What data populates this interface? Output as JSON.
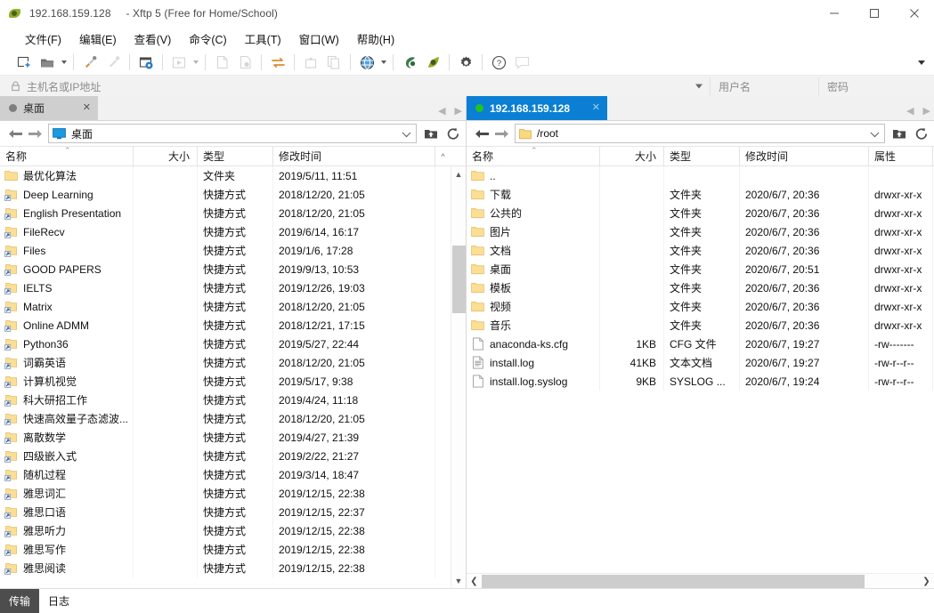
{
  "window": {
    "title_host": "192.168.159.128",
    "title_app": "- Xftp 5 (Free for Home/School)",
    "minimize_label": "—",
    "maximize_label": "□",
    "close_label": "✕"
  },
  "menubar": {
    "items": [
      {
        "label": "文件(F)"
      },
      {
        "label": "编辑(E)"
      },
      {
        "label": "查看(V)"
      },
      {
        "label": "命令(C)"
      },
      {
        "label": "工具(T)"
      },
      {
        "label": "窗口(W)"
      },
      {
        "label": "帮助(H)"
      }
    ]
  },
  "toolbar": {
    "buttons": [
      {
        "name": "new-session-icon"
      },
      {
        "name": "open-folder-icon"
      },
      {
        "name": "connect-icon"
      },
      {
        "name": "disconnect-icon"
      },
      {
        "name": "session-properties-icon"
      },
      {
        "name": "transfer-start-icon"
      },
      {
        "name": "new-file-icon"
      },
      {
        "name": "edit-file-icon"
      },
      {
        "name": "sync-browse-icon"
      },
      {
        "name": "upload-icon"
      },
      {
        "name": "copy-icon"
      },
      {
        "name": "browser-icon"
      },
      {
        "name": "xshell-icon"
      },
      {
        "name": "xftp-icon"
      },
      {
        "name": "options-icon"
      },
      {
        "name": "help-icon"
      },
      {
        "name": "feedback-icon"
      }
    ],
    "overflow_label": "▾"
  },
  "loginbar": {
    "host_placeholder": "主机名或IP地址",
    "host_value": "",
    "username_placeholder": "用户名",
    "username_value": "",
    "password_placeholder": "密码",
    "password_value": ""
  },
  "columns": {
    "name": "名称",
    "size": "大小",
    "type": "类型",
    "modified": "修改时间",
    "attr": "属性",
    "sort_mark": "⌃"
  },
  "left_pane": {
    "tab": {
      "label": "桌面",
      "close": "✕",
      "active": false
    },
    "path": "桌面",
    "nav_back": "←",
    "nav_forward": "→",
    "up_button": "up-folder-icon",
    "refresh_button": "refresh-icon",
    "rows": [
      {
        "name": "最优化算法",
        "size": "",
        "type": "文件夹",
        "modified": "2019/5/11, 11:51",
        "icon": "folder"
      },
      {
        "name": "Deep Learning",
        "size": "",
        "type": "快捷方式",
        "modified": "2018/12/20, 21:05",
        "icon": "shortcut"
      },
      {
        "name": "English Presentation",
        "size": "",
        "type": "快捷方式",
        "modified": "2018/12/20, 21:05",
        "icon": "shortcut"
      },
      {
        "name": "FileRecv",
        "size": "",
        "type": "快捷方式",
        "modified": "2019/6/14, 16:17",
        "icon": "shortcut"
      },
      {
        "name": "Files",
        "size": "",
        "type": "快捷方式",
        "modified": "2019/1/6, 17:28",
        "icon": "shortcut"
      },
      {
        "name": "GOOD PAPERS",
        "size": "",
        "type": "快捷方式",
        "modified": "2019/9/13, 10:53",
        "icon": "shortcut"
      },
      {
        "name": "IELTS",
        "size": "",
        "type": "快捷方式",
        "modified": "2019/12/26, 19:03",
        "icon": "shortcut"
      },
      {
        "name": "Matrix",
        "size": "",
        "type": "快捷方式",
        "modified": "2018/12/20, 21:05",
        "icon": "shortcut"
      },
      {
        "name": "Online ADMM",
        "size": "",
        "type": "快捷方式",
        "modified": "2018/12/21, 17:15",
        "icon": "shortcut"
      },
      {
        "name": "Python36",
        "size": "",
        "type": "快捷方式",
        "modified": "2019/5/27, 22:44",
        "icon": "shortcut"
      },
      {
        "name": "词霸英语",
        "size": "",
        "type": "快捷方式",
        "modified": "2018/12/20, 21:05",
        "icon": "shortcut"
      },
      {
        "name": "计算机视觉",
        "size": "",
        "type": "快捷方式",
        "modified": "2019/5/17, 9:38",
        "icon": "shortcut"
      },
      {
        "name": "科大研招工作",
        "size": "",
        "type": "快捷方式",
        "modified": "2019/4/24, 11:18",
        "icon": "shortcut"
      },
      {
        "name": "快速高效量子态滤波...",
        "size": "",
        "type": "快捷方式",
        "modified": "2018/12/20, 21:05",
        "icon": "shortcut"
      },
      {
        "name": "离散数学",
        "size": "",
        "type": "快捷方式",
        "modified": "2019/4/27, 21:39",
        "icon": "shortcut"
      },
      {
        "name": "四级嵌入式",
        "size": "",
        "type": "快捷方式",
        "modified": "2019/2/22, 21:27",
        "icon": "shortcut"
      },
      {
        "name": "随机过程",
        "size": "",
        "type": "快捷方式",
        "modified": "2019/3/14, 18:47",
        "icon": "shortcut"
      },
      {
        "name": "雅思词汇",
        "size": "",
        "type": "快捷方式",
        "modified": "2019/12/15, 22:38",
        "icon": "shortcut"
      },
      {
        "name": "雅思口语",
        "size": "",
        "type": "快捷方式",
        "modified": "2019/12/15, 22:37",
        "icon": "shortcut"
      },
      {
        "name": "雅思听力",
        "size": "",
        "type": "快捷方式",
        "modified": "2019/12/15, 22:38",
        "icon": "shortcut"
      },
      {
        "name": "雅思写作",
        "size": "",
        "type": "快捷方式",
        "modified": "2019/12/15, 22:38",
        "icon": "shortcut"
      },
      {
        "name": "雅思阅读",
        "size": "",
        "type": "快捷方式",
        "modified": "2019/12/15, 22:38",
        "icon": "shortcut"
      }
    ]
  },
  "right_pane": {
    "tab": {
      "label": "192.168.159.128",
      "close": "✕",
      "active": true
    },
    "path": "/root",
    "nav_back": "←",
    "nav_forward": "→",
    "rows": [
      {
        "name": "..",
        "size": "",
        "type": "",
        "modified": "",
        "attr": "",
        "icon": "folder"
      },
      {
        "name": "下载",
        "size": "",
        "type": "文件夹",
        "modified": "2020/6/7, 20:36",
        "attr": "drwxr-xr-x",
        "icon": "folder"
      },
      {
        "name": "公共的",
        "size": "",
        "type": "文件夹",
        "modified": "2020/6/7, 20:36",
        "attr": "drwxr-xr-x",
        "icon": "folder"
      },
      {
        "name": "图片",
        "size": "",
        "type": "文件夹",
        "modified": "2020/6/7, 20:36",
        "attr": "drwxr-xr-x",
        "icon": "folder"
      },
      {
        "name": "文档",
        "size": "",
        "type": "文件夹",
        "modified": "2020/6/7, 20:36",
        "attr": "drwxr-xr-x",
        "icon": "folder"
      },
      {
        "name": "桌面",
        "size": "",
        "type": "文件夹",
        "modified": "2020/6/7, 20:51",
        "attr": "drwxr-xr-x",
        "icon": "folder"
      },
      {
        "name": "模板",
        "size": "",
        "type": "文件夹",
        "modified": "2020/6/7, 20:36",
        "attr": "drwxr-xr-x",
        "icon": "folder"
      },
      {
        "name": "视频",
        "size": "",
        "type": "文件夹",
        "modified": "2020/6/7, 20:36",
        "attr": "drwxr-xr-x",
        "icon": "folder"
      },
      {
        "name": "音乐",
        "size": "",
        "type": "文件夹",
        "modified": "2020/6/7, 20:36",
        "attr": "drwxr-xr-x",
        "icon": "folder"
      },
      {
        "name": "anaconda-ks.cfg",
        "size": "1KB",
        "type": "CFG 文件",
        "modified": "2020/6/7, 19:27",
        "attr": "-rw-------",
        "icon": "file"
      },
      {
        "name": "install.log",
        "size": "41KB",
        "type": "文本文档",
        "modified": "2020/6/7, 19:27",
        "attr": "-rw-r--r--",
        "icon": "textfile"
      },
      {
        "name": "install.log.syslog",
        "size": "9KB",
        "type": "SYSLOG ...",
        "modified": "2020/6/7, 19:24",
        "attr": "-rw-r--r--",
        "icon": "file"
      }
    ]
  },
  "bottombar": {
    "tabs": [
      {
        "label": "传输",
        "active": true
      },
      {
        "label": "日志",
        "active": false
      }
    ]
  }
}
